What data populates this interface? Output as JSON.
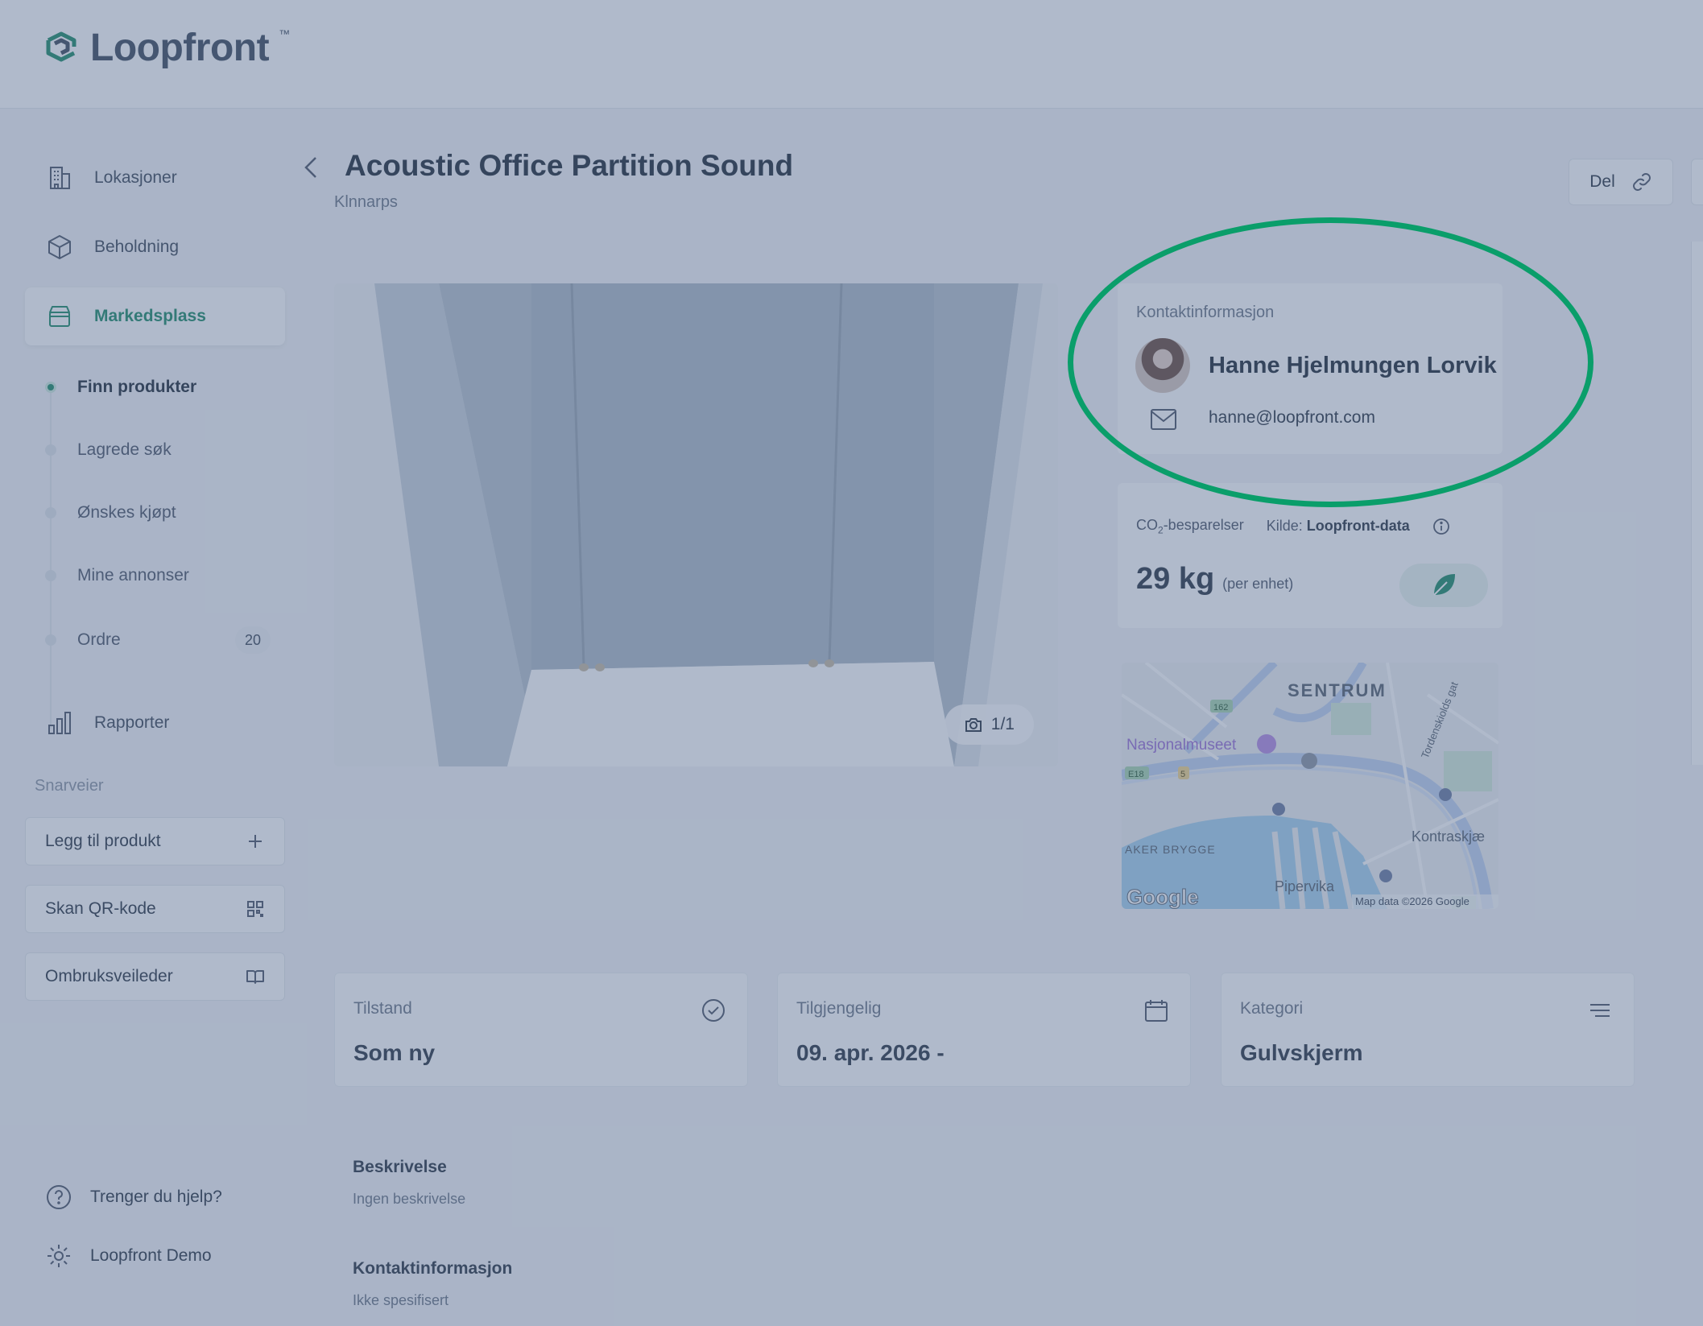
{
  "app": {
    "logo_text": "Loopfront",
    "logo_tm": "™"
  },
  "sidebar": {
    "items": [
      {
        "label": "Lokasjoner",
        "icon": "building-icon"
      },
      {
        "label": "Beholdning",
        "icon": "box-icon"
      },
      {
        "label": "Markedsplass",
        "icon": "store-icon",
        "active": true
      }
    ],
    "sub_items": [
      {
        "label": "Finn produkter",
        "active": true
      },
      {
        "label": "Lagrede søk"
      },
      {
        "label": "Ønskes kjøpt"
      },
      {
        "label": "Mine annonser"
      },
      {
        "label": "Ordre",
        "badge": "20"
      }
    ],
    "reports": {
      "label": "Rapporter",
      "icon": "bar-chart-icon"
    },
    "shortcuts_label": "Snarveier",
    "shortcuts": [
      {
        "label": "Legg til produkt",
        "icon": "plus-icon"
      },
      {
        "label": "Skan QR-kode",
        "icon": "qr-code-icon"
      },
      {
        "label": "Ombruksveileder",
        "icon": "book-icon"
      }
    ],
    "footer": {
      "help": "Trenger du hjelp?",
      "settings": "Loopfront Demo"
    }
  },
  "product": {
    "title": "Acoustic Office Partition Sound",
    "brand": "Klnnarps",
    "share_label": "Del",
    "photo_counter": "1/1"
  },
  "contact": {
    "label": "Kontaktinformasjon",
    "name": "Hanne Hjelmungen Lorvik",
    "email": "hanne@loopfront.com"
  },
  "co2": {
    "label_prefix": "CO",
    "label_sub": "2",
    "label_suffix": "-besparelser",
    "source_label": "Kilde:",
    "source_value": "Loopfront-data",
    "value": "29 kg",
    "unit": "(per enhet)"
  },
  "map": {
    "labels": {
      "district": "SENTRUM",
      "museum": "Nasjonalmuseet",
      "aker": "AKER BRYGGE",
      "pipervika": "Pipervika",
      "kontraskjae": "Kontraskjæ",
      "tordenskjold": "Tordenskiolds gat",
      "road_162": "162",
      "road_e18": "E18",
      "road_5": "5"
    },
    "google": "Google",
    "attribution": "Map data ©2026 Google"
  },
  "details": [
    {
      "label": "Tilstand",
      "value": "Som ny",
      "icon": "check-badge-icon"
    },
    {
      "label": "Tilgjengelig",
      "value": "09. apr. 2026 -",
      "icon": "calendar-icon"
    },
    {
      "label": "Kategori",
      "value": "Gulvskjerm",
      "icon": "list-icon"
    }
  ],
  "description": {
    "heading": "Beskrivelse",
    "text": "Ingen beskrivelse",
    "contact_heading": "Kontaktinformasjon",
    "contact_text": "Ikke spesifisert"
  },
  "colors": {
    "accent": "#1d8a66",
    "highlight": "#0a9e6a",
    "overlay": "#50668c"
  }
}
